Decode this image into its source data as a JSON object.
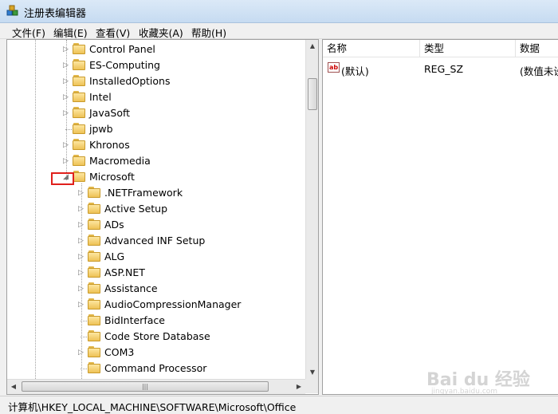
{
  "window": {
    "title": "注册表编辑器"
  },
  "menu": [
    {
      "label": "文件(F)"
    },
    {
      "label": "编辑(E)"
    },
    {
      "label": "查看(V)"
    },
    {
      "label": "收藏夹(A)"
    },
    {
      "label": "帮助(H)"
    }
  ],
  "tree": [
    {
      "label": "Control Panel",
      "level": 1,
      "expander": "collapsed"
    },
    {
      "label": "ES-Computing",
      "level": 1,
      "expander": "collapsed"
    },
    {
      "label": "InstalledOptions",
      "level": 1,
      "expander": "collapsed"
    },
    {
      "label": "Intel",
      "level": 1,
      "expander": "collapsed"
    },
    {
      "label": "JavaSoft",
      "level": 1,
      "expander": "collapsed"
    },
    {
      "label": "jpwb",
      "level": 1,
      "expander": "none"
    },
    {
      "label": "Khronos",
      "level": 1,
      "expander": "collapsed"
    },
    {
      "label": "Macromedia",
      "level": 1,
      "expander": "collapsed"
    },
    {
      "label": "Microsoft",
      "level": 1,
      "expander": "expanded"
    },
    {
      "label": ".NETFramework",
      "level": 2,
      "expander": "collapsed"
    },
    {
      "label": "Active Setup",
      "level": 2,
      "expander": "collapsed"
    },
    {
      "label": "ADs",
      "level": 2,
      "expander": "collapsed"
    },
    {
      "label": "Advanced INF Setup",
      "level": 2,
      "expander": "collapsed"
    },
    {
      "label": "ALG",
      "level": 2,
      "expander": "collapsed"
    },
    {
      "label": "ASP.NET",
      "level": 2,
      "expander": "collapsed"
    },
    {
      "label": "Assistance",
      "level": 2,
      "expander": "collapsed"
    },
    {
      "label": "AudioCompressionManager",
      "level": 2,
      "expander": "collapsed"
    },
    {
      "label": "BidInterface",
      "level": 2,
      "expander": "none"
    },
    {
      "label": "Code Store Database",
      "level": 2,
      "expander": "none"
    },
    {
      "label": "COM3",
      "level": 2,
      "expander": "collapsed"
    },
    {
      "label": "Command Processor",
      "level": 2,
      "expander": "none"
    }
  ],
  "values_pane": {
    "headers": {
      "name": "名称",
      "type": "类型",
      "data": "数据"
    },
    "rows": [
      {
        "name": "(默认)",
        "type": "REG_SZ",
        "data": "(数值未设置)",
        "icon": "string-value-icon"
      }
    ]
  },
  "status": {
    "path": "计算机\\HKEY_LOCAL_MACHINE\\SOFTWARE\\Microsoft\\Office"
  },
  "watermark": {
    "text": "Bai du 经验",
    "sub": "jingyan.baidu.com"
  },
  "colors": {
    "highlight_box": "#e0201c",
    "folder": "#eec256"
  }
}
